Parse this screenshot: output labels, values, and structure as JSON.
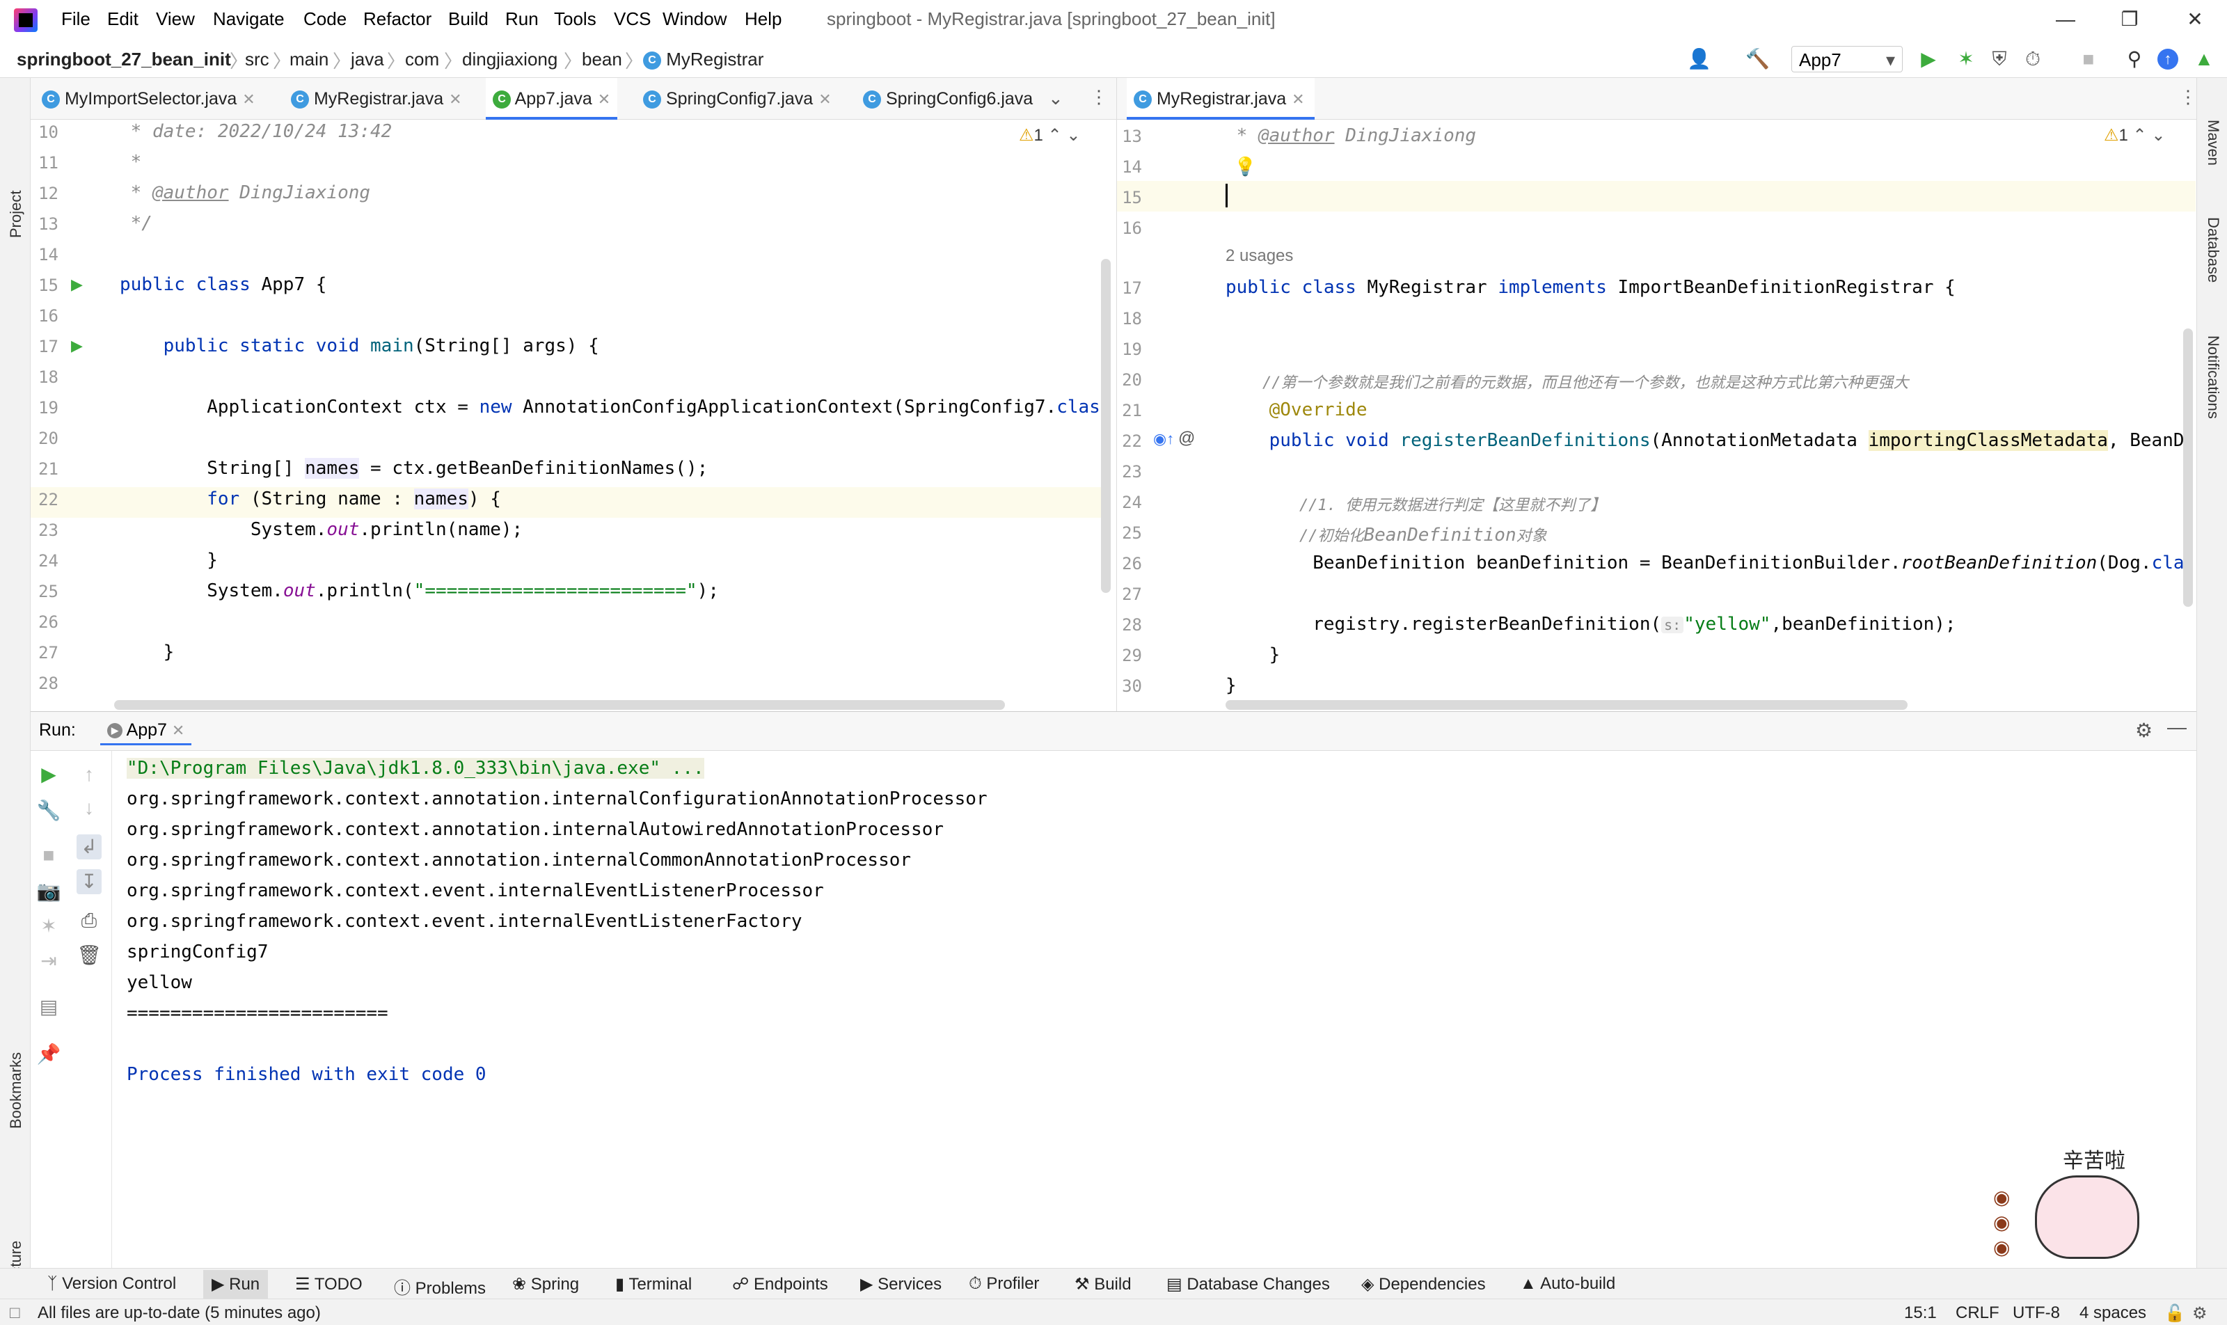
{
  "menu": {
    "items": [
      "File",
      "Edit",
      "View",
      "Navigate",
      "Code",
      "Refactor",
      "Build",
      "Run",
      "Tools",
      "VCS",
      "Window",
      "Help"
    ],
    "window_title": "springboot - MyRegistrar.java [springboot_27_bean_init]"
  },
  "breadcrumb": [
    "springboot_27_bean_init",
    "src",
    "main",
    "java",
    "com",
    "dingjiaxiong",
    "bean",
    "MyRegistrar"
  ],
  "toolbar": {
    "run_config": "App7"
  },
  "left_tools": {
    "project": "Project",
    "bookmarks": "Bookmarks",
    "structure": "Structure"
  },
  "right_tools": {
    "maven": "Maven",
    "database": "Database",
    "notifications": "Notifications"
  },
  "left_tabs": [
    "MyImportSelector.java",
    "MyRegistrar.java",
    "App7.java",
    "SpringConfig7.java",
    "SpringConfig6.java"
  ],
  "right_tabs": [
    "MyRegistrar.java"
  ],
  "left_editor": {
    "warning_count": "1",
    "lines": [
      "10",
      "11",
      "12",
      "13",
      "14",
      "15",
      "16",
      "17",
      "18",
      "19",
      "20",
      "21",
      "22",
      "23",
      "24",
      "25",
      "26",
      "27",
      "28"
    ],
    "code": {
      "l10": " * date: 2022/10/24 13:42",
      "l11": " *",
      "l12a": " * ",
      "l12b": "@author",
      "l12c": " DingJiaxiong",
      "l13": " */",
      "l15a": "public class ",
      "l15b": "App7 {",
      "l17a": "    public static void ",
      "l17b": "main",
      "l17c": "(String[] args) {",
      "l19a": "        ApplicationContext ctx = ",
      "l19b": "new",
      "l19c": " AnnotationConfigApplicationContext(SpringConfig7.",
      "l19d": "class",
      "l21a": "        String[] ",
      "l21b": "names",
      "l21c": " = ctx.getBeanDefinitionNames();",
      "l22a": "        ",
      "l22b": "for",
      "l22c": " (String name : ",
      "l22d": "names",
      "l22e": ") {",
      "l23a": "            System.",
      "l23b": "out",
      "l23c": ".println(name);",
      "l24": "        }",
      "l25a": "        System.",
      "l25b": "out",
      "l25c": ".println(",
      "l25d": "\"========================\"",
      "l25e": ");",
      "l27": "    }",
      "l29": "}"
    }
  },
  "right_editor": {
    "warning_count": "1",
    "usages": "2 usages",
    "lines": [
      "13",
      "14",
      "15",
      "16",
      "17",
      "18",
      "19",
      "20",
      "21",
      "22",
      "23",
      "24",
      "25",
      "26",
      "27",
      "28",
      "29",
      "30"
    ],
    "code": {
      "l13a": " * ",
      "l13b": "@author",
      "l13c": " DingJiaxiong",
      "l17a": "public class ",
      "l17b": "MyRegistrar ",
      "l17c": "implements",
      "l17d": " ImportBeanDefinitionRegistrar {",
      "l20": "    //第一个参数就是我们之前看的元数据，而且他还有一个参数，也就是这种方式比第六种更强大",
      "l21": "    @Override",
      "l22a": "    public void ",
      "l22b": "registerBeanDefinitions",
      "l22c": "(AnnotationMetadata ",
      "l22d": "importingClassMetadata",
      "l22e": ", BeanD",
      "l24": "        //1. 使用元数据进行判定【这里就不判了】",
      "l25a": "        //初始化",
      "l25b": "BeanDefinition",
      "l25c": "对象",
      "l26a": "        BeanDefinition beanDefinition = BeanDefinitionBuilder.",
      "l26b": "rootBeanDefinition",
      "l26c": "(Dog.",
      "l26d": "cla",
      "l28a": "        registry.registerBeanDefinition(",
      "l28hint": "s:",
      "l28b": "\"yellow\"",
      "l28c": ",beanDefinition);",
      "l29": "    }",
      "l30": "}"
    }
  },
  "run": {
    "label": "Run:",
    "tab": "App7",
    "output": [
      "\"D:\\Program Files\\Java\\jdk1.8.0_333\\bin\\java.exe\" ...",
      "org.springframework.context.annotation.internalConfigurationAnnotationProcessor",
      "org.springframework.context.annotation.internalAutowiredAnnotationProcessor",
      "org.springframework.context.annotation.internalCommonAnnotationProcessor",
      "org.springframework.context.event.internalEventListenerProcessor",
      "org.springframework.context.event.internalEventListenerFactory",
      "springConfig7",
      "yellow",
      "========================",
      "",
      "Process finished with exit code 0"
    ]
  },
  "bottom_tabs": [
    "Version Control",
    "Run",
    "TODO",
    "Problems",
    "Spring",
    "Terminal",
    "Endpoints",
    "Services",
    "Profiler",
    "Build",
    "Database Changes",
    "Dependencies",
    "Auto-build"
  ],
  "status": {
    "message": "All files are up-to-date (5 minutes ago)",
    "position": "15:1",
    "line_sep": "CRLF",
    "encoding": "UTF-8",
    "indent": "4 spaces"
  },
  "sticker": {
    "caption": "辛苦啦"
  },
  "colors": {
    "accent": "#3574f0",
    "keyword": "#0033b3",
    "string": "#067d17",
    "annotation": "#9e880d",
    "run_green": "#3dab3d"
  }
}
